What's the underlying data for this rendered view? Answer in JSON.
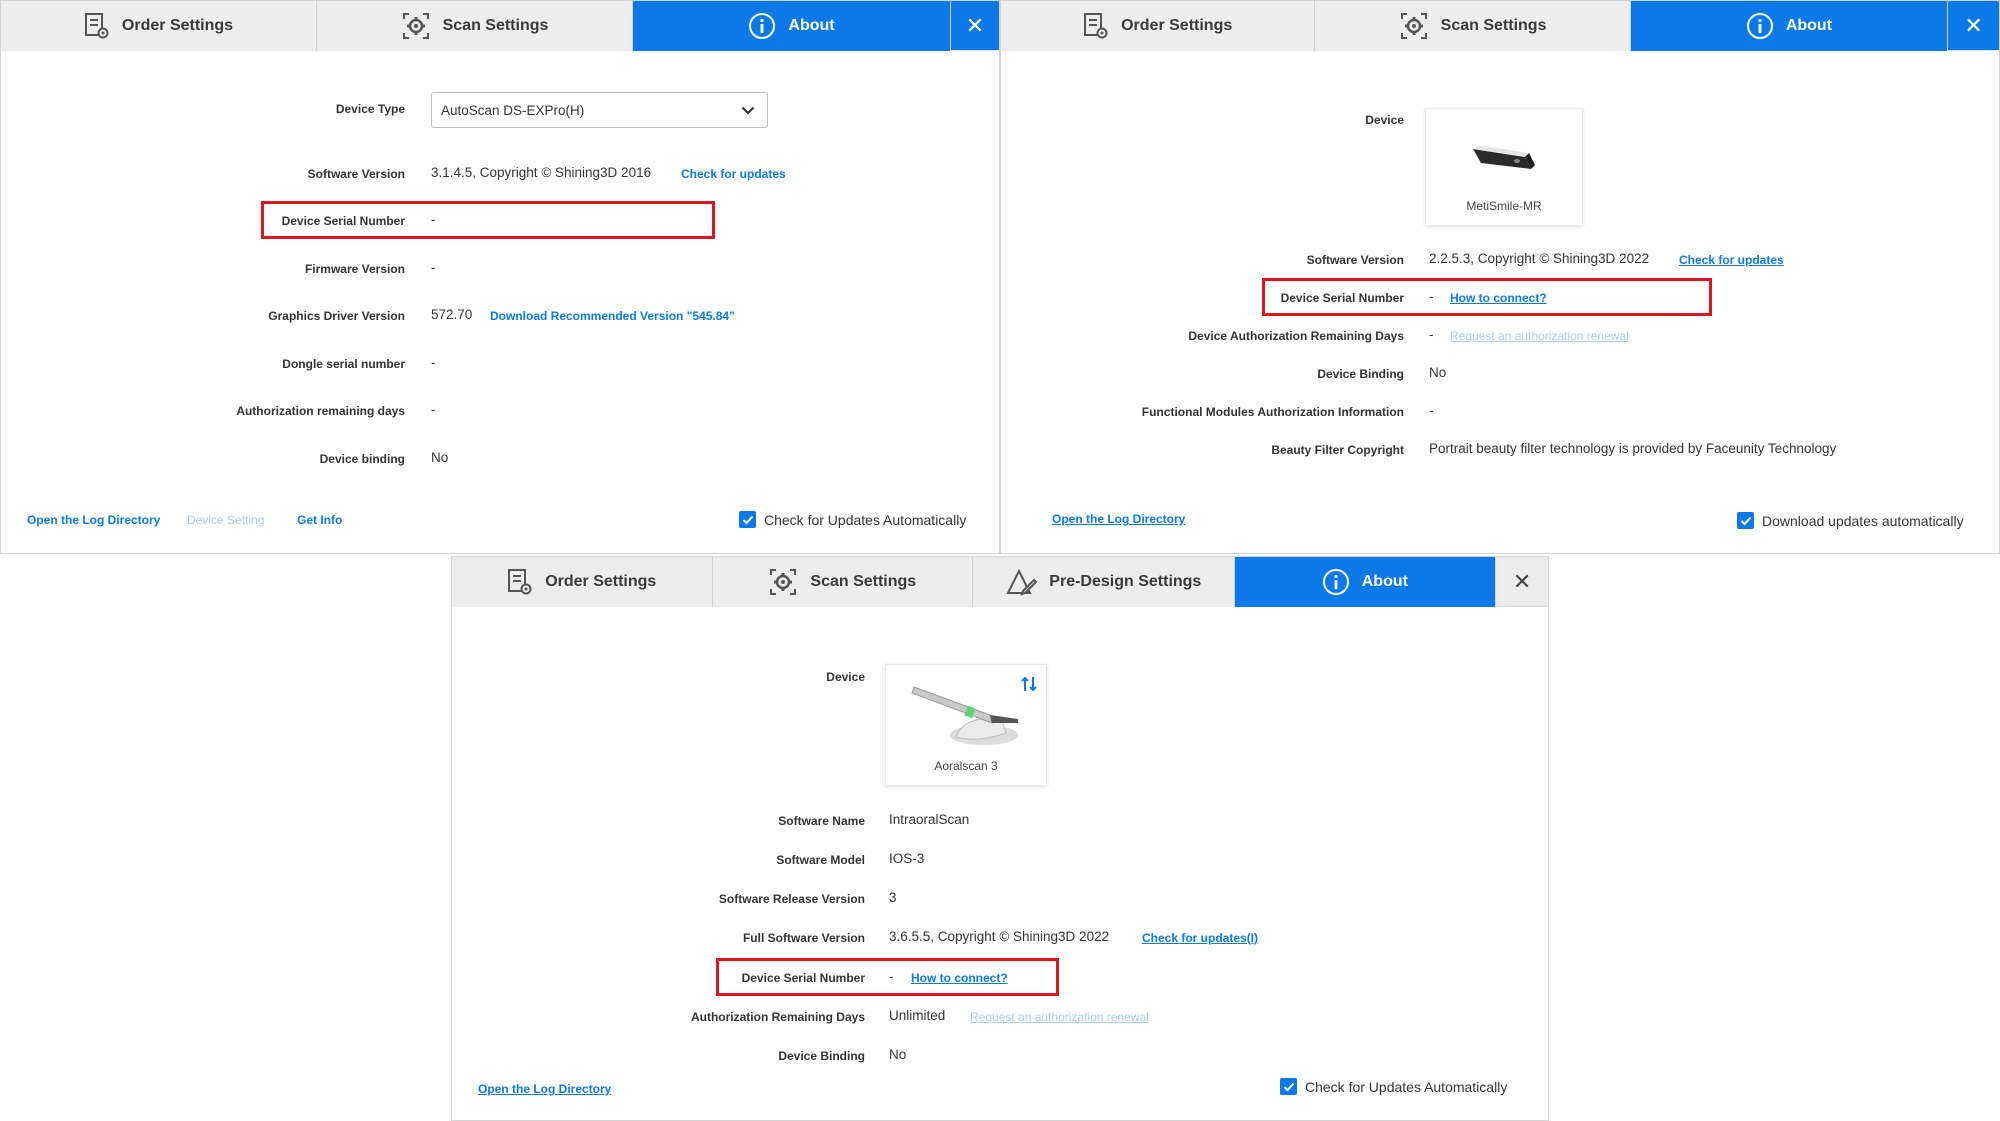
{
  "panel_a": {
    "tabs": [
      {
        "label": "Order Settings",
        "icon": "order-settings-icon"
      },
      {
        "label": "Scan Settings",
        "icon": "gear-icon"
      },
      {
        "label": "About",
        "icon": "info-icon"
      }
    ],
    "close": "✕",
    "rows": {
      "device_type": {
        "label": "Device Type",
        "value": "AutoScan DS-EXPro(H)"
      },
      "software_version": {
        "label": "Software Version",
        "value": "3.1.4.5, Copyright © Shining3D 2016",
        "link": "Check for updates"
      },
      "device_serial": {
        "label": "Device Serial Number",
        "value": "-"
      },
      "firmware_version": {
        "label": "Firmware Version",
        "value": "-"
      },
      "graphics_driver": {
        "label": "Graphics Driver Version",
        "value": "572.70",
        "link": "Download Recommended Version \"545.84\""
      },
      "dongle_serial": {
        "label": "Dongle serial number",
        "value": "-"
      },
      "auth_remaining": {
        "label": "Authorization remaining days",
        "value": "-"
      },
      "device_binding": {
        "label": "Device binding",
        "value": "No"
      }
    },
    "footer": {
      "open_log": "Open the Log Directory",
      "device_setting": "Device Setting",
      "get_info": "Get Info",
      "auto_update": "Check for Updates Automatically",
      "auto_update_checked": true
    }
  },
  "panel_b": {
    "tabs": [
      {
        "label": "Order Settings",
        "icon": "order-settings-icon"
      },
      {
        "label": "Scan Settings",
        "icon": "gear-icon"
      },
      {
        "label": "About",
        "icon": "info-icon"
      }
    ],
    "close": "✕",
    "device": {
      "label": "Device",
      "name": "MetiSmile-MR",
      "image": "scanner-device-image"
    },
    "rows": {
      "software_version": {
        "label": "Software Version",
        "value": "2.2.5.3, Copyright © Shining3D 2022",
        "link": "Check for updates"
      },
      "device_serial": {
        "label": "Device Serial Number",
        "value": "-",
        "link": "How to connect?"
      },
      "auth_remaining": {
        "label": "Device Authorization Remaining Days",
        "value": "-",
        "link": "Request an authorization renewal"
      },
      "device_binding": {
        "label": "Device Binding",
        "value": "No"
      },
      "functional_modules": {
        "label": "Functional Modules Authorization Information",
        "value": "-"
      },
      "beauty_filter": {
        "label": "Beauty Filter Copyright",
        "value": "Portrait beauty filter technology is provided by Faceunity Technology"
      }
    },
    "footer": {
      "open_log": "Open the Log Directory",
      "auto_update": "Download updates automatically",
      "auto_update_checked": true
    }
  },
  "panel_c": {
    "tabs": [
      {
        "label": "Order Settings",
        "icon": "order-settings-icon"
      },
      {
        "label": "Scan Settings",
        "icon": "gear-icon"
      },
      {
        "label": "Pre-Design Settings",
        "icon": "pre-design-icon"
      },
      {
        "label": "About",
        "icon": "info-icon"
      }
    ],
    "close": "✕",
    "device": {
      "label": "Device",
      "name": "Aoralscan 3",
      "image": "intraoral-scanner-image"
    },
    "rows": {
      "software_name": {
        "label": "Software Name",
        "value": "IntraoralScan"
      },
      "software_model": {
        "label": "Software Model",
        "value": "IOS-3"
      },
      "release_version": {
        "label": "Software Release Version",
        "value": "3"
      },
      "full_version": {
        "label": "Full Software Version",
        "value": "3.6.5.5, Copyright © Shining3D 2022",
        "link": "Check for updates(I)"
      },
      "device_serial": {
        "label": "Device Serial Number",
        "value": "-",
        "link": "How to connect?"
      },
      "auth_remaining": {
        "label": "Authorization Remaining Days",
        "value": "Unlimited",
        "link": "Request an authorization renewal"
      },
      "device_binding": {
        "label": "Device Binding",
        "value": "No"
      }
    },
    "footer": {
      "open_log": "Open the Log Directory",
      "auto_update": "Check for Updates Automatically",
      "auto_update_checked": true
    }
  },
  "colors": {
    "accent": "#0b79e8",
    "highlight": "#e0141e",
    "tab_bg": "#ededed"
  }
}
